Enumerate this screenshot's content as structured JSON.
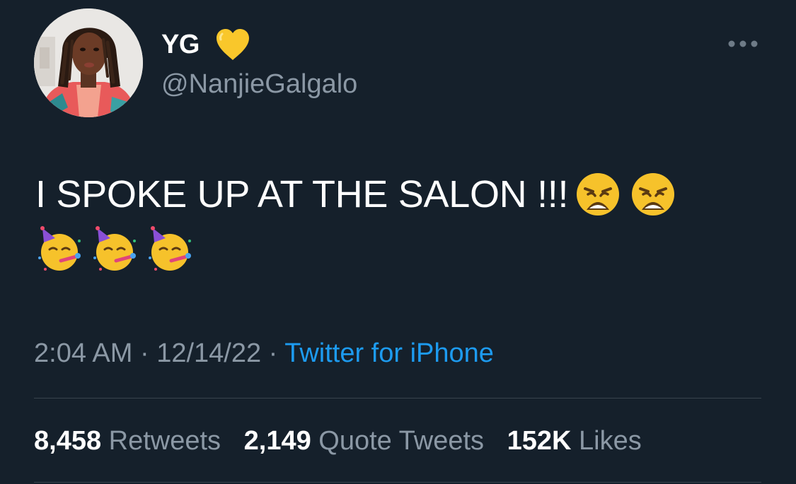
{
  "author": {
    "name": "YG",
    "handle": "@NanjieGalgalo",
    "badge_icon": "yellow-heart-icon"
  },
  "tweet": {
    "line1_text": "I SPOKE UP AT THE SALON !!!",
    "line1_emojis": [
      "weary-face-icon",
      "weary-face-icon"
    ],
    "line2_emojis": [
      "partying-face-icon",
      "partying-face-icon",
      "partying-face-icon"
    ]
  },
  "meta": {
    "time": "2:04 AM",
    "separator1": " · ",
    "date": "12/14/22",
    "separator2": " · ",
    "source": "Twitter for iPhone"
  },
  "stats": {
    "retweets_count": "8,458",
    "retweets_label": "Retweets",
    "quotes_count": "2,149",
    "quotes_label": "Quote Tweets",
    "likes_count": "152K",
    "likes_label": "Likes"
  },
  "colors": {
    "background": "#15202b",
    "text": "#ffffff",
    "secondary": "#8b98a5",
    "link": "#1d9bf0",
    "divider": "#38444d"
  }
}
